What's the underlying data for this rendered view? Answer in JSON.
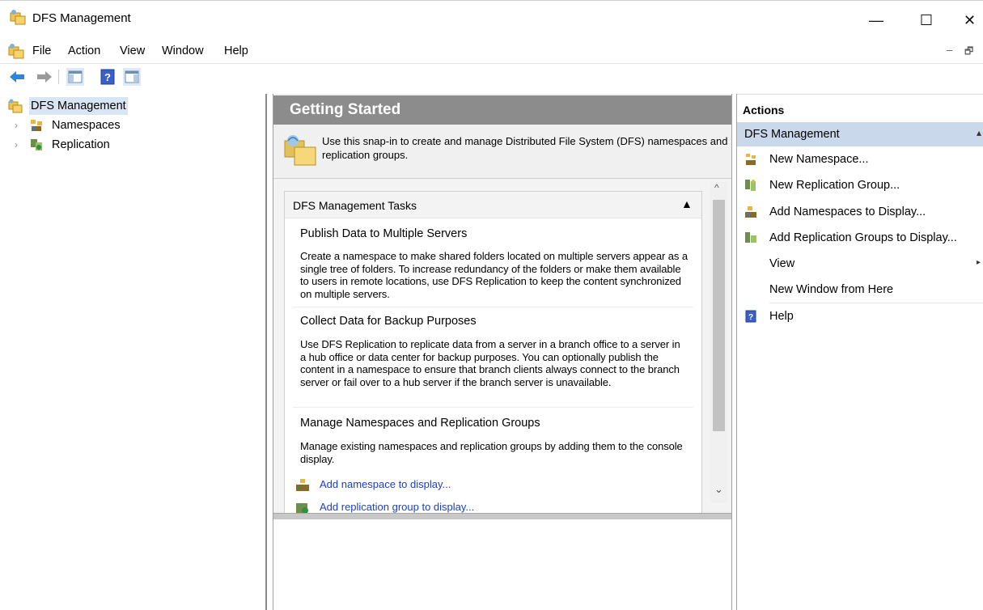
{
  "window": {
    "title": "DFS Management",
    "controls": {
      "minimize": "—",
      "maximize": "☐",
      "close": "✕"
    }
  },
  "menu": {
    "items": [
      "File",
      "Action",
      "View",
      "Window",
      "Help"
    ],
    "mdi_controls": {
      "minimize": "–",
      "restore": "🗗"
    }
  },
  "tree": {
    "root": "DFS Management",
    "children": [
      "Namespaces",
      "Replication"
    ]
  },
  "getting_started": {
    "header": "Getting Started",
    "intro": "Use this snap-in to create and manage Distributed File System (DFS) namespaces and replication groups.",
    "tasks_title": "DFS Management Tasks",
    "collapse_glyph": "▲",
    "sections": [
      {
        "title": "Publish Data to Multiple Servers",
        "text": "Create a namespace to make shared folders located on multiple servers appear as a single tree of folders. To increase redundancy of the folders or make them available to users in remote locations, use DFS Replication to keep the content synchronized on multiple servers."
      },
      {
        "title": "Collect Data for Backup Purposes",
        "text": "Use DFS Replication to replicate data from a server in a branch office to a server in a hub office or data center for backup purposes. You can optionally publish the content in a namespace to ensure that branch clients always connect to the branch server or fail over to a hub server if the branch server is unavailable."
      },
      {
        "title": "Manage Namespaces and Replication Groups",
        "text": "Manage existing namespaces and replication groups by adding them to the console display."
      }
    ],
    "links": [
      "Add namespace to display...",
      "Add replication group to display..."
    ],
    "scroll": {
      "up": "^",
      "down": "⌄"
    }
  },
  "actions": {
    "header": "Actions",
    "group": "DFS Management",
    "items": [
      {
        "label": "New Namespace...",
        "icon": "new-namespace-icon"
      },
      {
        "label": "New Replication Group...",
        "icon": "new-replication-group-icon"
      },
      {
        "label": "Add Namespaces to Display...",
        "icon": "add-namespaces-icon"
      },
      {
        "label": "Add Replication Groups to Display...",
        "icon": "add-replication-groups-icon"
      },
      {
        "label": "View",
        "icon": ""
      },
      {
        "label": "New Window from Here",
        "icon": ""
      },
      {
        "label": "Help",
        "icon": "help-icon"
      }
    ]
  },
  "colors": {
    "header_gray": "#8c8c8c",
    "selection_blue": "#c9d9eb",
    "link_blue": "#1a3ec8"
  }
}
